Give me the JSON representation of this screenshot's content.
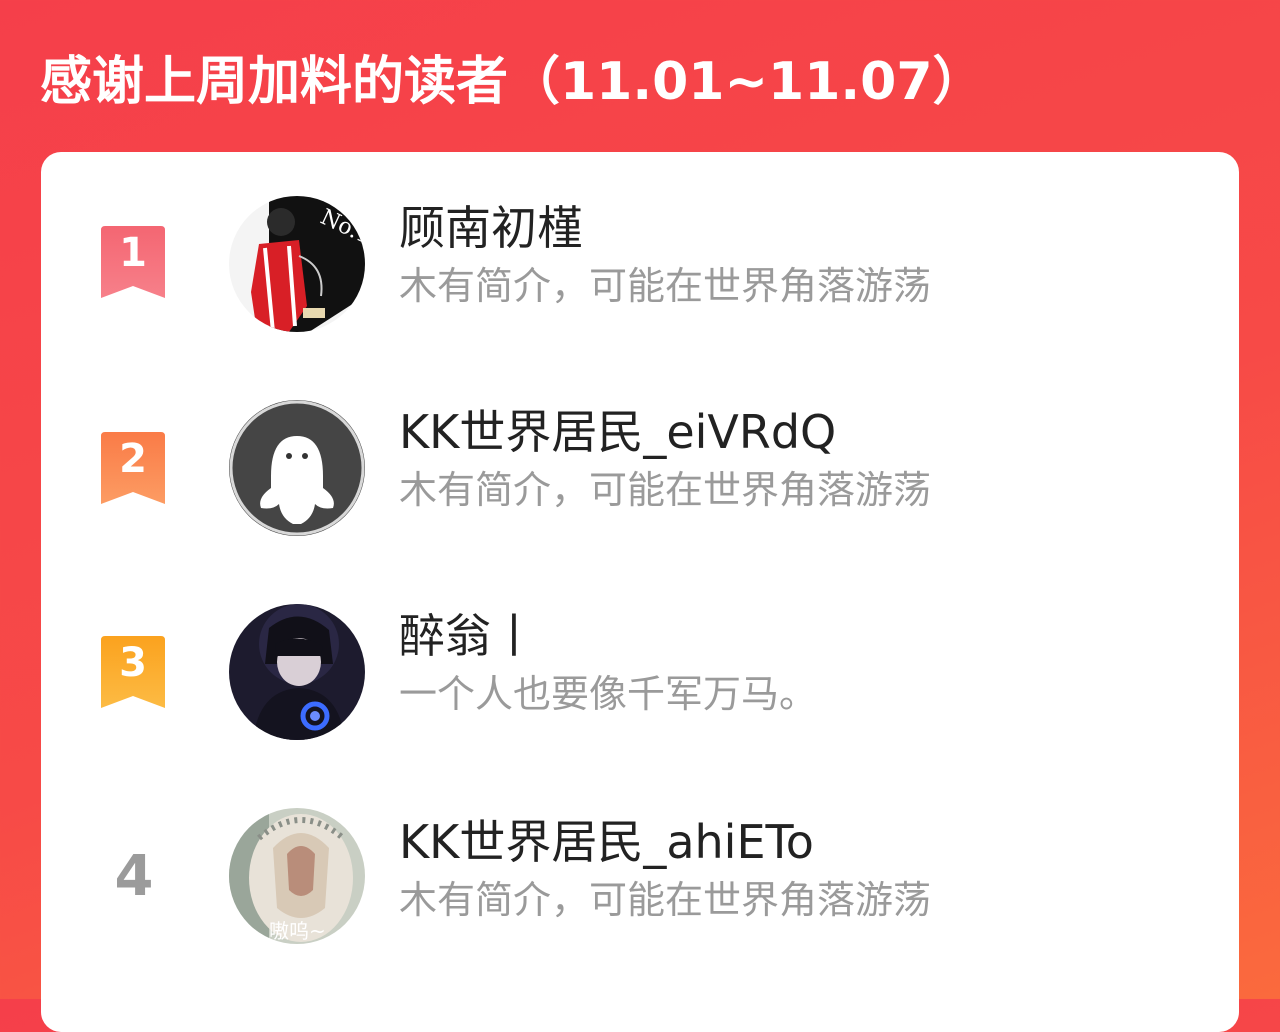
{
  "header": {
    "title": "感谢上周加料的读者（11.01~11.07）"
  },
  "colors": {
    "rank1": "#f25a66",
    "rank2": "#fb8a4e",
    "rank3": "#fbaa26",
    "rank_plain": "#9b9b9b"
  },
  "readers": [
    {
      "rank": "1",
      "name": "顾南初槿",
      "bio": "木有简介，可能在世界角落游荡",
      "avatar_icon": "anime-avatar-icon"
    },
    {
      "rank": "2",
      "name": "KK世界居民_eiVRdQ",
      "bio": "木有简介，可能在世界角落游荡",
      "avatar_icon": "default-ghost-avatar-icon"
    },
    {
      "rank": "3",
      "name": "醉翁丨",
      "bio": "一个人也要像千军万马。",
      "avatar_icon": "anime-avatar-icon"
    },
    {
      "rank": "4",
      "name": "KK世界居民_ahiETo",
      "bio": "木有简介，可能在世界角落游荡",
      "avatar_icon": "cat-photo-avatar-icon",
      "avatar_text": "嗷呜~"
    }
  ]
}
